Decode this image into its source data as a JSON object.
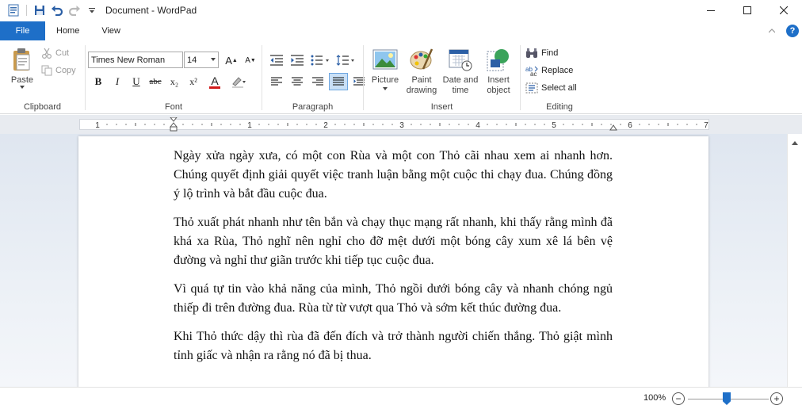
{
  "window": {
    "title": "Document - WordPad"
  },
  "tabs": {
    "file": "File",
    "home": "Home",
    "view": "View"
  },
  "ribbon": {
    "clipboard": {
      "label": "Clipboard",
      "paste": "Paste",
      "cut": "Cut",
      "copy": "Copy"
    },
    "font": {
      "label": "Font",
      "family": "Times New Roman",
      "size": "14",
      "bold": "B",
      "italic": "I",
      "underline": "U",
      "strikethrough": "abc",
      "subscript": "x₂",
      "superscript": "x²",
      "color_letter": "A",
      "font_color": "#d11a1a",
      "grow": "A",
      "shrink": "A"
    },
    "paragraph": {
      "label": "Paragraph"
    },
    "insert": {
      "label": "Insert",
      "picture": "Picture",
      "paint_drawing_1": "Paint",
      "paint_drawing_2": "drawing",
      "date_time_1": "Date and",
      "date_time_2": "time",
      "insert_object_1": "Insert",
      "insert_object_2": "object"
    },
    "editing": {
      "label": "Editing",
      "find": "Find",
      "replace": "Replace",
      "select_all": "Select all"
    }
  },
  "ruler": {
    "labels": [
      "1",
      "1",
      "2",
      "3",
      "4",
      "5",
      "6",
      "7"
    ]
  },
  "document": {
    "paragraphs": [
      "Ngày xửa ngày xưa, có một con Rùa và một con Thỏ cãi nhau xem ai nhanh hơn. Chúng quyết định giải quyết việc tranh luận bằng một cuộc thi chạy đua. Chúng đồng ý lộ trình và bắt đầu cuộc đua.",
      "Thỏ xuất phát nhanh như tên bắn và chạy thục mạng rất nhanh, khi thấy rằng mình đã khá xa Rùa, Thỏ nghĩ nên nghỉ cho đỡ mệt dưới một bóng cây xum xê lá bên vệ đường và nghỉ thư giãn trước khi tiếp tục cuộc đua.",
      "Vì quá tự tin vào khả năng của mình, Thỏ ngồi dưới bóng cây và nhanh chóng ngủ thiếp đi trên đường đua. Rùa từ từ vượt qua Thỏ và sớm kết thúc đường đua.",
      "Khi Thỏ thức dậy thì rùa đã đến đích và trở thành người chiến thắng. Thỏ giật mình tỉnh giấc và nhận ra rằng nó đã bị thua."
    ]
  },
  "status": {
    "zoom": "100%",
    "minus": "−",
    "plus": "+"
  },
  "help": {
    "symbol": "?"
  },
  "colors": {
    "accent": "#1e6fc8"
  }
}
